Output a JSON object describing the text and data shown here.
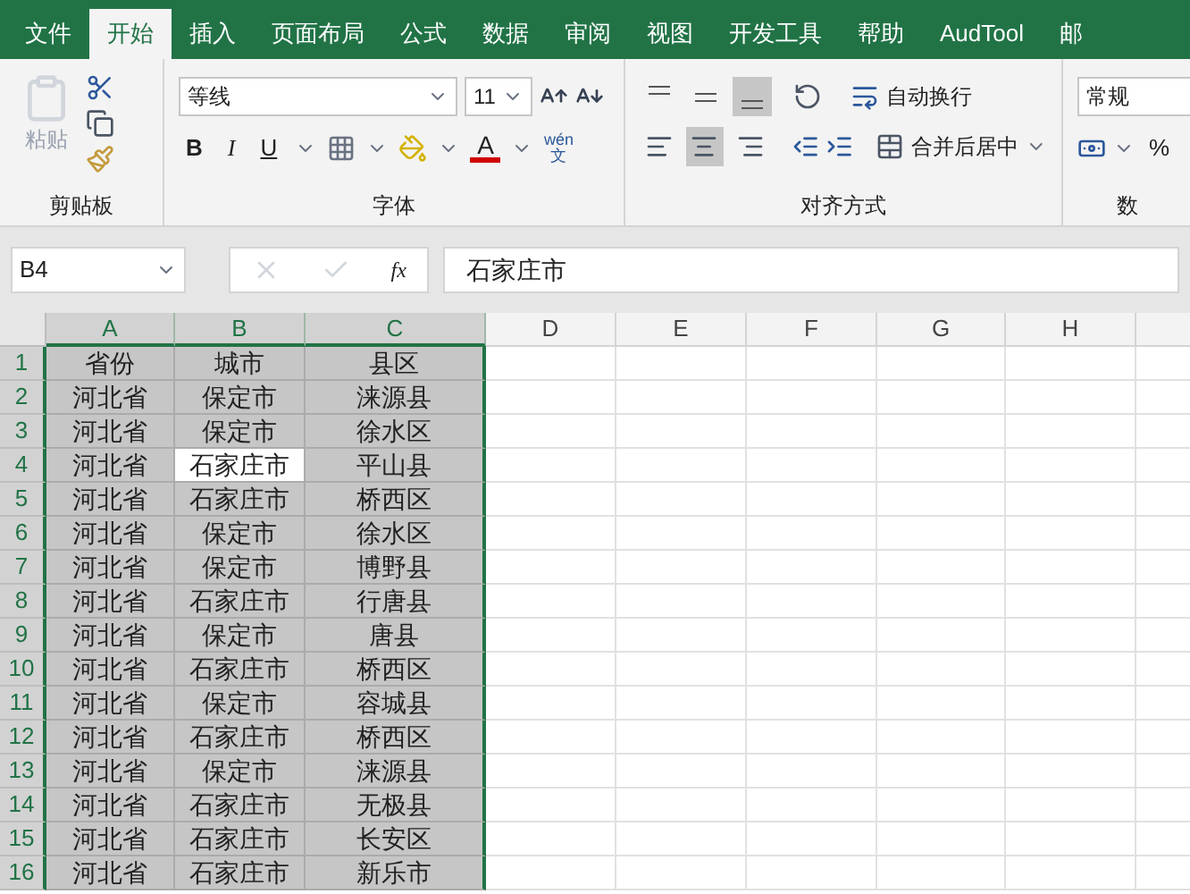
{
  "tabs": [
    {
      "label": "文件",
      "selected": false
    },
    {
      "label": "开始",
      "selected": true
    },
    {
      "label": "插入",
      "selected": false
    },
    {
      "label": "页面布局",
      "selected": false
    },
    {
      "label": "公式",
      "selected": false
    },
    {
      "label": "数据",
      "selected": false
    },
    {
      "label": "审阅",
      "selected": false
    },
    {
      "label": "视图",
      "selected": false
    },
    {
      "label": "开发工具",
      "selected": false
    },
    {
      "label": "帮助",
      "selected": false
    },
    {
      "label": "AudTool",
      "selected": false
    },
    {
      "label": "邮",
      "selected": false
    }
  ],
  "clipboard": {
    "paste_label": "粘贴",
    "group_label": "剪贴板"
  },
  "font": {
    "name": "等线",
    "size": "11",
    "bold": "B",
    "italic": "I",
    "underline": "U",
    "font_color": "A",
    "phonetic_top": "wén",
    "phonetic_bottom": "文",
    "group_label": "字体"
  },
  "alignment": {
    "vertical": [
      {
        "kind": "top",
        "selected": false
      },
      {
        "kind": "middle",
        "selected": false
      },
      {
        "kind": "bottom",
        "selected": true
      }
    ],
    "horizontal": [
      {
        "kind": "left",
        "selected": false
      },
      {
        "kind": "center",
        "selected": true
      },
      {
        "kind": "right",
        "selected": false
      }
    ],
    "wrap_text": "自动换行",
    "merge_center": "合并后居中",
    "group_label": "对齐方式"
  },
  "number": {
    "format": "常规",
    "percent": "%",
    "group_label": "数"
  },
  "formula_bar": {
    "name_box": "B4",
    "fx": "fx",
    "value": "石家庄市"
  },
  "sheet": {
    "columns": [
      {
        "label": "A",
        "selected": true
      },
      {
        "label": "B",
        "selected": true
      },
      {
        "label": "C",
        "selected": true
      },
      {
        "label": "D",
        "selected": false
      },
      {
        "label": "E",
        "selected": false
      },
      {
        "label": "F",
        "selected": false
      },
      {
        "label": "G",
        "selected": false
      },
      {
        "label": "H",
        "selected": false
      }
    ],
    "rows": [
      {
        "number": "1",
        "selected": true,
        "cells": [
          {
            "text": "省份",
            "active": false
          },
          {
            "text": "城市",
            "active": false
          },
          {
            "text": "县区",
            "active": false
          }
        ]
      },
      {
        "number": "2",
        "selected": true,
        "cells": [
          {
            "text": "河北省",
            "active": false
          },
          {
            "text": "保定市",
            "active": false
          },
          {
            "text": "涞源县",
            "active": false
          }
        ]
      },
      {
        "number": "3",
        "selected": true,
        "cells": [
          {
            "text": "河北省",
            "active": false
          },
          {
            "text": "保定市",
            "active": false
          },
          {
            "text": "徐水区",
            "active": false
          }
        ]
      },
      {
        "number": "4",
        "selected": true,
        "cells": [
          {
            "text": "河北省",
            "active": false
          },
          {
            "text": "石家庄市",
            "active": true
          },
          {
            "text": "平山县",
            "active": false
          }
        ]
      },
      {
        "number": "5",
        "selected": true,
        "cells": [
          {
            "text": "河北省",
            "active": false
          },
          {
            "text": "石家庄市",
            "active": false
          },
          {
            "text": "桥西区",
            "active": false
          }
        ]
      },
      {
        "number": "6",
        "selected": true,
        "cells": [
          {
            "text": "河北省",
            "active": false
          },
          {
            "text": "保定市",
            "active": false
          },
          {
            "text": "徐水区",
            "active": false
          }
        ]
      },
      {
        "number": "7",
        "selected": true,
        "cells": [
          {
            "text": "河北省",
            "active": false
          },
          {
            "text": "保定市",
            "active": false
          },
          {
            "text": "博野县",
            "active": false
          }
        ]
      },
      {
        "number": "8",
        "selected": true,
        "cells": [
          {
            "text": "河北省",
            "active": false
          },
          {
            "text": "石家庄市",
            "active": false
          },
          {
            "text": "行唐县",
            "active": false
          }
        ]
      },
      {
        "number": "9",
        "selected": true,
        "cells": [
          {
            "text": "河北省",
            "active": false
          },
          {
            "text": "保定市",
            "active": false
          },
          {
            "text": "唐县",
            "active": false
          }
        ]
      },
      {
        "number": "10",
        "selected": true,
        "cells": [
          {
            "text": "河北省",
            "active": false
          },
          {
            "text": "石家庄市",
            "active": false
          },
          {
            "text": "桥西区",
            "active": false
          }
        ]
      },
      {
        "number": "11",
        "selected": true,
        "cells": [
          {
            "text": "河北省",
            "active": false
          },
          {
            "text": "保定市",
            "active": false
          },
          {
            "text": "容城县",
            "active": false
          }
        ]
      },
      {
        "number": "12",
        "selected": true,
        "cells": [
          {
            "text": "河北省",
            "active": false
          },
          {
            "text": "石家庄市",
            "active": false
          },
          {
            "text": "桥西区",
            "active": false
          }
        ]
      },
      {
        "number": "13",
        "selected": true,
        "cells": [
          {
            "text": "河北省",
            "active": false
          },
          {
            "text": "保定市",
            "active": false
          },
          {
            "text": "涞源县",
            "active": false
          }
        ]
      },
      {
        "number": "14",
        "selected": true,
        "cells": [
          {
            "text": "河北省",
            "active": false
          },
          {
            "text": "石家庄市",
            "active": false
          },
          {
            "text": "无极县",
            "active": false
          }
        ]
      },
      {
        "number": "15",
        "selected": true,
        "cells": [
          {
            "text": "河北省",
            "active": false
          },
          {
            "text": "石家庄市",
            "active": false
          },
          {
            "text": "长安区",
            "active": false
          }
        ]
      },
      {
        "number": "16",
        "selected": true,
        "cells": [
          {
            "text": "河北省",
            "active": false
          },
          {
            "text": "石家庄市",
            "active": false
          },
          {
            "text": "新乐市",
            "active": false
          }
        ]
      }
    ]
  }
}
